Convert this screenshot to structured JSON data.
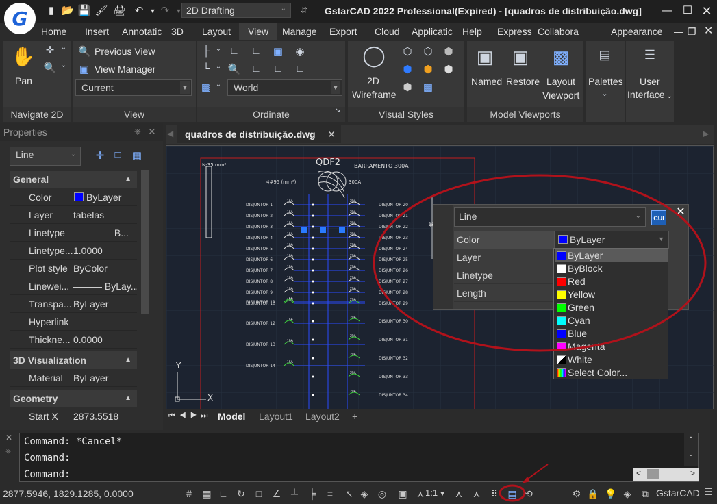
{
  "app": {
    "title": "GstarCAD 2022 Professional(Expired) - [quadros de distribuição.dwg]",
    "logo_letter": "G",
    "workspace": "2D Drafting"
  },
  "menu": [
    "Home",
    "Insert",
    "Annotatic",
    "3D",
    "Layout",
    "View",
    "Manage",
    "Export",
    "Cloud",
    "Applicatic",
    "Help",
    "Express",
    "Collabora"
  ],
  "menu_active": "View",
  "appearance": "Appearance",
  "ribbon": {
    "navigate": {
      "title": "Navigate 2D",
      "pan": "Pan"
    },
    "view": {
      "title": "View",
      "previous_view": "Previous View",
      "view_manager": "View Manager",
      "current": "Current"
    },
    "ordinate": {
      "title": "Ordinate",
      "world": "World"
    },
    "visual_styles": {
      "title": "Visual Styles",
      "wire_l1": "2D",
      "wire_l2": "Wireframe"
    },
    "model_viewports": {
      "title": "Model Viewports",
      "named": "Named",
      "restore": "Restore",
      "layout_l1": "Layout",
      "layout_l2": "Viewport"
    },
    "palettes": "Palettes",
    "ui_l1": "User",
    "ui_l2": "Interface"
  },
  "properties": {
    "title": "Properties",
    "selector": "Line",
    "general": "General",
    "rows": [
      {
        "k": "Color",
        "v": "ByLayer",
        "swatch": "#0000ff"
      },
      {
        "k": "Layer",
        "v": "tabelas"
      },
      {
        "k": "Linetype",
        "v": "———— B..."
      },
      {
        "k": "Linetype...",
        "v": "1.0000"
      },
      {
        "k": "Plot style",
        "v": "ByColor"
      },
      {
        "k": "Linewei...",
        "v": "——— ByLay..."
      },
      {
        "k": "Transpa...",
        "v": "ByLayer"
      },
      {
        "k": "Hyperlink",
        "v": ""
      },
      {
        "k": "Thickne...",
        "v": "0.0000"
      }
    ],
    "viz": "3D Visualization",
    "material_k": "Material",
    "material_v": "ByLayer",
    "geometry": "Geometry",
    "startx_k": "Start X",
    "startx_v": "2873.5518"
  },
  "drawing": {
    "tab": "quadros de distribuição.dwg",
    "qdf": "QDF2",
    "barramento": "BARRAMENTO 300A",
    "n35": "N-35 mm²",
    "bus": "4#95 (mm²)",
    "bus_a": "300A",
    "left_labels": [
      "DISJUNTOR 1",
      "DISJUNTOR 2",
      "DISJUNTOR 3",
      "DISJUNTOR 4",
      "DISJUNTOR 5",
      "DISJUNTOR 6",
      "DISJUNTOR 7",
      "DISJUNTOR 8",
      "DISJUNTOR 9",
      "DISJUNTOR 10",
      "DISJUNTOR 11",
      "DISJUNTOR 12",
      "DISJUNTOR 13",
      "DISJUNTOR 14"
    ],
    "right_labels": [
      "DISJUNTOR 20",
      "DISJUNTOR 21",
      "DISJUNTOR 22",
      "DISJUNTOR 23",
      "DISJUNTOR 24",
      "DISJUNTOR 25",
      "DISJUNTOR 26",
      "DISJUNTOR 27",
      "DISJUNTOR 28",
      "DISJUNTOR 29",
      "DISJUNTOR 30",
      "DISJUNTOR 31",
      "DISJUNTOR 32",
      "DISJUNTOR 33",
      "DISJUNTOR 34"
    ],
    "amp_l": "16A",
    "amp_r": "20A",
    "axis_y": "Y",
    "axis_x": "X"
  },
  "layout_tabs": {
    "model": "Model",
    "l1": "Layout1",
    "l2": "Layout2",
    "add": "+"
  },
  "quick_props": {
    "type": "Line",
    "cui": "CUI",
    "labels": [
      "Color",
      "Layer",
      "Linetype",
      "Length"
    ],
    "color_value": "ByLayer",
    "colors": [
      {
        "name": "ByLayer",
        "hex": "#0000ff"
      },
      {
        "name": "ByBlock",
        "hex": "#ffffff"
      },
      {
        "name": "Red",
        "hex": "#ff0000"
      },
      {
        "name": "Yellow",
        "hex": "#ffff00"
      },
      {
        "name": "Green",
        "hex": "#00ff00"
      },
      {
        "name": "Cyan",
        "hex": "#00ffff"
      },
      {
        "name": "Blue",
        "hex": "#0000ff"
      },
      {
        "name": "Magenta",
        "hex": "#ff00ff"
      },
      {
        "name": "White",
        "hex": "#ffffff"
      },
      {
        "name": "Select Color...",
        "hex": "multi"
      }
    ]
  },
  "command": {
    "lines": [
      "Command: *Cancel*",
      "Command:",
      "Command:"
    ]
  },
  "status": {
    "coords": "2877.5946, 1829.1285, 0.0000",
    "scale": "1:1",
    "brand": "GstarCAD"
  },
  "colors": {
    "accent": "#0078d7",
    "annotation_red": "#b0121b",
    "canvas": "#1c2330"
  }
}
